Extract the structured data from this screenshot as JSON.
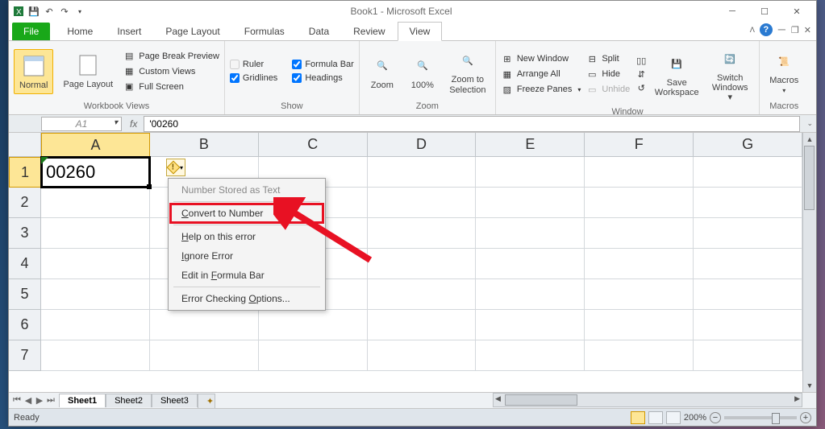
{
  "app_title": "Book1 - Microsoft Excel",
  "tabs": {
    "file": "File",
    "home": "Home",
    "insert": "Insert",
    "page_layout": "Page Layout",
    "formulas": "Formulas",
    "data": "Data",
    "review": "Review",
    "view": "View"
  },
  "ribbon": {
    "workbook_views": {
      "label": "Workbook Views",
      "normal": "Normal",
      "page_layout": "Page Layout",
      "page_break_preview": "Page Break Preview",
      "custom_views": "Custom Views",
      "full_screen": "Full Screen"
    },
    "show": {
      "label": "Show",
      "ruler": "Ruler",
      "gridlines": "Gridlines",
      "formula_bar": "Formula Bar",
      "headings": "Headings"
    },
    "zoom": {
      "label": "Zoom",
      "zoom": "Zoom",
      "hundred": "100%",
      "selection": "Zoom to Selection"
    },
    "window": {
      "label": "Window",
      "new_window": "New Window",
      "arrange_all": "Arrange All",
      "freeze_panes": "Freeze Panes",
      "split": "Split",
      "hide": "Hide",
      "unhide": "Unhide",
      "save_workspace": "Save Workspace",
      "switch_windows": "Switch Windows"
    },
    "macros": {
      "label": "Macros",
      "macros": "Macros"
    }
  },
  "name_box": "A1",
  "formula_value": "'00260",
  "columns": [
    "A",
    "B",
    "C",
    "D",
    "E",
    "F",
    "G"
  ],
  "rows": [
    "1",
    "2",
    "3",
    "4",
    "5",
    "6",
    "7"
  ],
  "cell_A1": "00260",
  "error_menu": {
    "title": "Number Stored as Text",
    "convert": "Convert to Number",
    "help": "Help on this error",
    "ignore": "Ignore Error",
    "edit": "Edit in Formula Bar",
    "options": "Error Checking Options..."
  },
  "sheets": {
    "s1": "Sheet1",
    "s2": "Sheet2",
    "s3": "Sheet3"
  },
  "status": {
    "ready": "Ready",
    "zoom": "200%"
  }
}
